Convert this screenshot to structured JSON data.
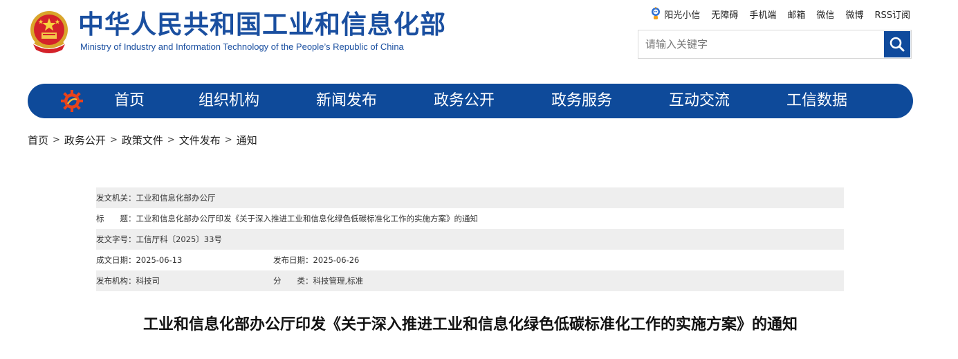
{
  "header": {
    "title": "中华人民共和国工业和信息化部",
    "subtitle": "Ministry of Industry and Information Technology of the People’s Republic of China",
    "brand_color": "#1a4fa0",
    "top_links": [
      "阳光小信",
      "无障碍",
      "手机端",
      "邮箱",
      "微信",
      "微博",
      "RSS订阅"
    ],
    "search": {
      "placeholder": "请输入关键字",
      "value": "",
      "button_icon": "search-icon"
    }
  },
  "nav": {
    "color": "#0e4a9a",
    "items": [
      "首页",
      "组织机构",
      "新闻发布",
      "政务公开",
      "政务服务",
      "互动交流",
      "工信数据"
    ]
  },
  "breadcrumb": [
    "首页",
    "政务公开",
    "政策文件",
    "文件发布",
    "通知"
  ],
  "breadcrumb_separator": ">",
  "meta": {
    "issuer_label": "发文机关：",
    "issuer": "工业和信息化部办公厅",
    "title_label": "标　　题：",
    "title": "工业和信息化部办公厅印发《关于深入推进工业和信息化绿色低碳标准化工作的实施方案》的通知",
    "doc_no_label": "发文字号：",
    "doc_no": "工信厅科〔2025〕33号",
    "written_date_label": "成文日期：",
    "written_date": "2025-06-13",
    "publish_date_label": "发布日期：",
    "publish_date": "2025-06-26",
    "agency_label": "发布机构：",
    "agency": "科技司",
    "category_label": "分　　类：",
    "category": "科技管理,标准"
  },
  "article": {
    "title": "工业和信息化部办公厅印发《关于深入推进工业和信息化绿色低碳标准化工作的实施方案》的通知"
  }
}
